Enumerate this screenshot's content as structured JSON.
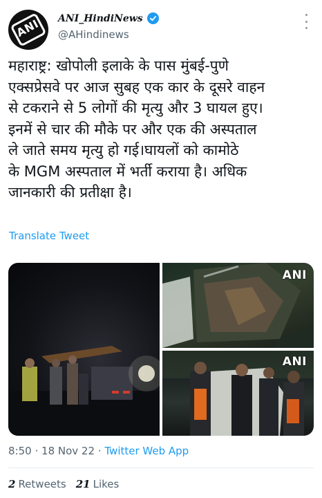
{
  "author": {
    "display_name": "ANI_HindiNews",
    "handle": "@AHindinews",
    "avatar_label": "ANI",
    "verified": true
  },
  "tweet": {
    "text": "महाराष्ट्र: खोपोली इलाके के पास मुंबई-पुणे\nएक्सप्रेसवे पर आज सुबह एक कार के दूसरे वाहन\nसे टकराने से 5 लोगों की मृत्यु और 3 घायल हुए।\nइनमें से चार की मौके पर और एक की अस्पताल\nले जाते समय मृत्यु हो गई।घायलों को कामोठे\nके MGM अस्पताल में भर्ती कराया है। अधिक\nजानकारी की प्रतीक्षा है।",
    "translate_label": "Translate Tweet"
  },
  "media": {
    "watermark": "ANI"
  },
  "meta": {
    "time": "8:50",
    "date": "18 Nov 22",
    "separator": "·",
    "source": "Twitter Web App"
  },
  "stats": {
    "retweets_count": "2",
    "retweets_label": "Retweets",
    "likes_count": "21",
    "likes_label": "Likes"
  },
  "colors": {
    "link": "#1d9bf0",
    "secondary_text": "#536471",
    "primary_text": "#0f1419"
  }
}
